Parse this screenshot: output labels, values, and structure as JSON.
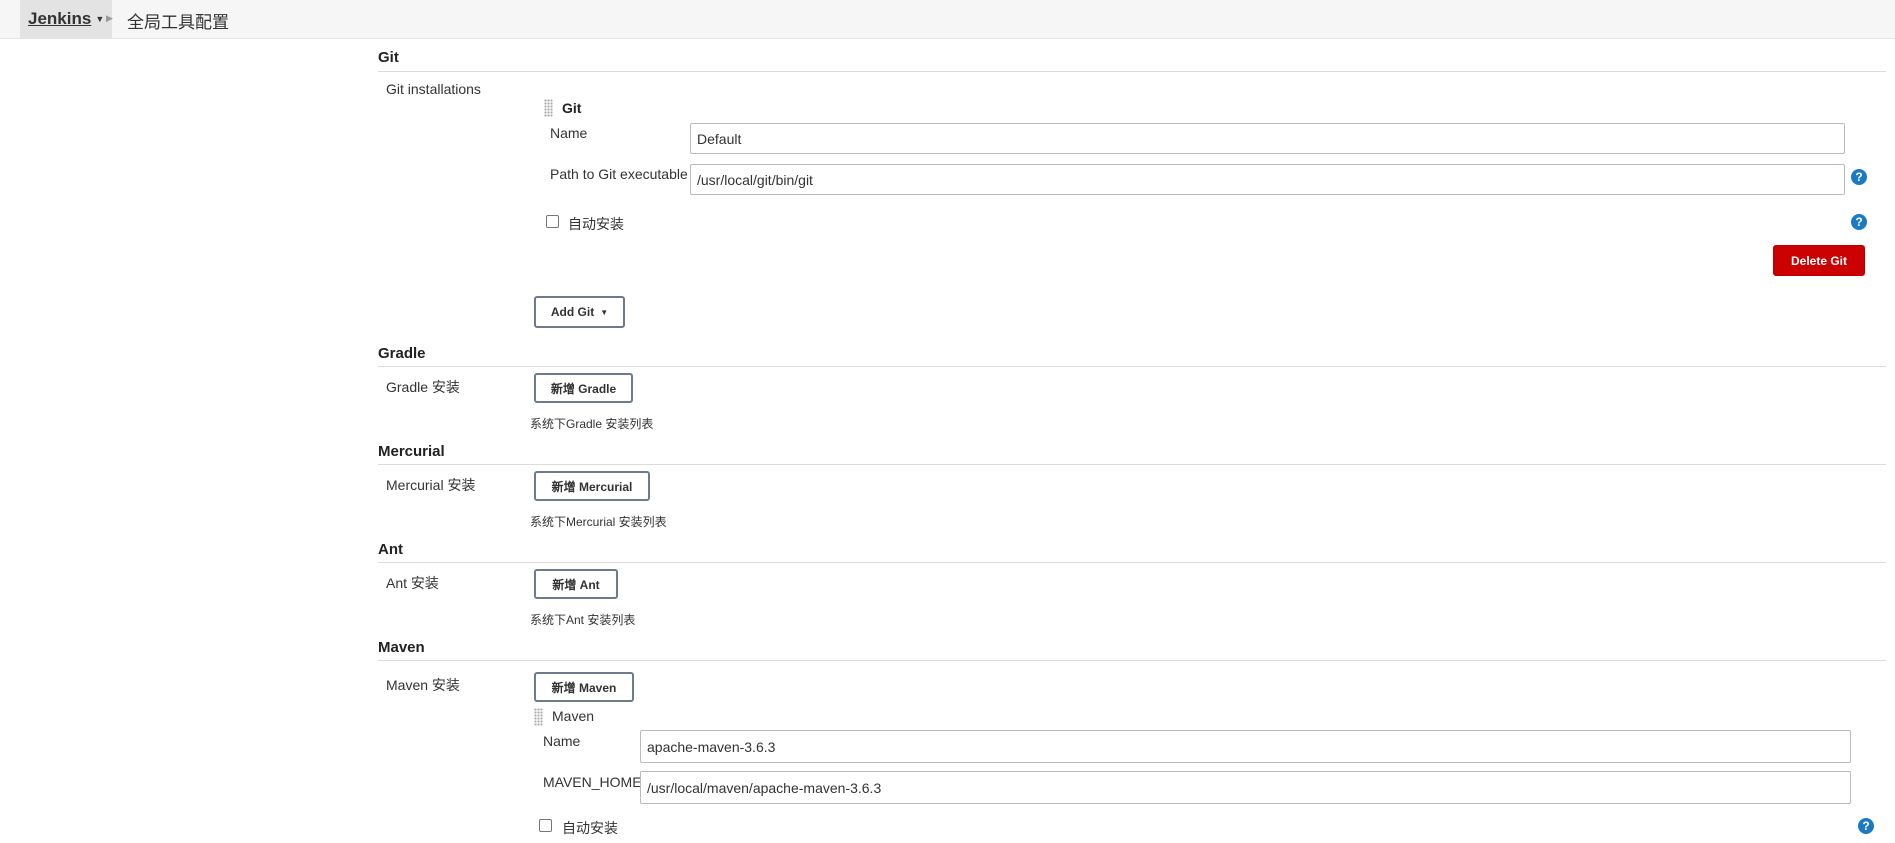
{
  "breadcrumb": {
    "home": "Jenkins",
    "page": "全局工具配置"
  },
  "git": {
    "section_title": "Git",
    "installations_label": "Git installations",
    "item_title": "Git",
    "name_label": "Name",
    "name_value": "Default",
    "path_label": "Path to Git executable",
    "path_value": "/usr/local/git/bin/git",
    "auto_install_label": "自动安装",
    "delete_button": "Delete Git",
    "add_button": "Add Git"
  },
  "gradle": {
    "section_title": "Gradle",
    "install_label": "Gradle 安装",
    "add_button": "新增 Gradle",
    "help_text": "系统下Gradle 安装列表"
  },
  "mercurial": {
    "section_title": "Mercurial",
    "install_label": "Mercurial 安装",
    "add_button": "新增 Mercurial",
    "help_text": "系统下Mercurial 安装列表"
  },
  "ant": {
    "section_title": "Ant",
    "install_label": "Ant 安装",
    "add_button": "新增 Ant",
    "help_text": "系统下Ant 安装列表"
  },
  "maven": {
    "section_title": "Maven",
    "install_label": "Maven 安装",
    "add_button": "新增 Maven",
    "item_title": "Maven",
    "name_label": "Name",
    "name_value": "apache-maven-3.6.3",
    "home_label": "MAVEN_HOME",
    "home_value": "/usr/local/maven/apache-maven-3.6.3",
    "auto_install_label": "自动安装"
  },
  "icons": {
    "help": "help-icon",
    "drag": "drag-handle-icon",
    "dropdown": "chevron-down-icon",
    "separator": "chevron-right-icon"
  },
  "colors": {
    "danger": "#cc0000",
    "help": "#1a7ac6",
    "topbar": "#f6f6f6"
  }
}
